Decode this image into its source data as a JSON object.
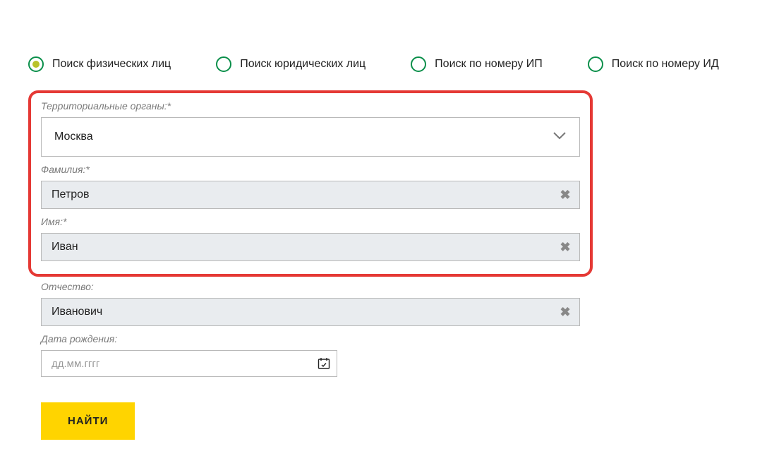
{
  "radios": {
    "individuals": "Поиск физических лиц",
    "legal": "Поиск юридических лиц",
    "ip": "Поиск по номеру ИП",
    "id": "Поиск по номеру ИД"
  },
  "fields": {
    "territory": {
      "label": "Территориальные органы:*",
      "value": "Москва"
    },
    "lastname": {
      "label": "Фамилия:*",
      "value": "Петров"
    },
    "firstname": {
      "label": "Имя:*",
      "value": "Иван"
    },
    "patronymic": {
      "label": "Отчество:",
      "value": "Иванович"
    },
    "birthdate": {
      "label": "Дата рождения:",
      "placeholder": "дд.мм.гггг"
    }
  },
  "submit": "НАЙТИ"
}
